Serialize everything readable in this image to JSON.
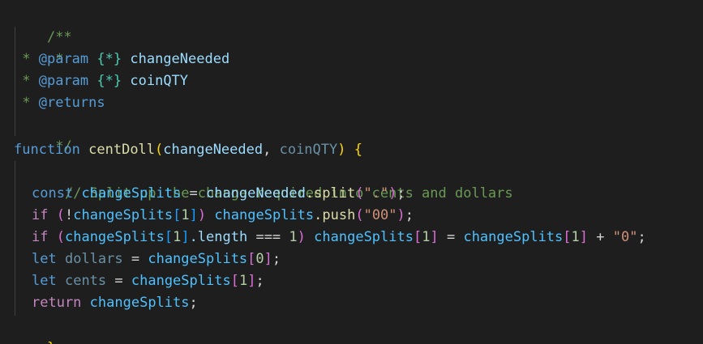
{
  "doc_comment": {
    "open": "/**",
    "star": " *",
    "param1_tag": "@param",
    "param1_type": "{*}",
    "param1_name": "changeNeeded",
    "param2_tag": "@param",
    "param2_type": "{*}",
    "param2_name": "coinQTY",
    "returns_tag": "@returns",
    "close": " */"
  },
  "function_decl": {
    "keyword": "function",
    "name": "centDoll",
    "open_paren": "(",
    "param1": "changeNeeded",
    "comma": ", ",
    "param2": "coinQTY",
    "close_paren": ")",
    "open_brace": "{"
  },
  "body": {
    "comment": "// Split up the change required into cents and dollars",
    "line1": {
      "kw": "const",
      "name": "changeSplits",
      "eq": " = ",
      "obj": "changeNeeded",
      "dot_method": ".split",
      "lp": "(",
      "str": "\".\"",
      "rp": ")",
      "semi": ";"
    },
    "line2": {
      "kw": "if",
      "lp": "(",
      "not": "!",
      "name": "changeSplits",
      "lb": "[",
      "idx": "1",
      "rb": "]",
      "rp": ")",
      "obj": "changeSplits",
      "dot_method": ".push",
      "lp2": "(",
      "str": "\"00\"",
      "rp2": ")",
      "semi": ";"
    },
    "line3": {
      "kw": "if",
      "lp": "(",
      "name": "changeSplits",
      "lb": "[",
      "idx": "1",
      "rb": "]",
      "prop": ".length",
      "op": " === ",
      "num": "1",
      "rp": ")",
      "name2": "changeSplits",
      "lb2": "[",
      "idx2": "1",
      "rb2": "]",
      "eq": " = ",
      "name3": "changeSplits",
      "lb3": "[",
      "idx3": "1",
      "rb3": "]",
      "plus": " + ",
      "str": "\"0\"",
      "semi": ";"
    },
    "line4": {
      "kw": "let",
      "name": "dollars",
      "eq": " = ",
      "obj": "changeSplits",
      "lb": "[",
      "idx": "0",
      "rb": "]",
      "semi": ";"
    },
    "line5": {
      "kw": "let",
      "name": "cents",
      "eq": " = ",
      "obj": "changeSplits",
      "lb": "[",
      "idx": "1",
      "rb": "]",
      "semi": ";"
    },
    "line6": {
      "kw": "return",
      "name": "changeSplits",
      "semi": ";"
    }
  },
  "close_brace": "}",
  "colors": {
    "background": "#1e1e1e",
    "comment": "#6a9955",
    "keyword": "#569cd6",
    "control": "#c586c0",
    "function": "#dcdcaa",
    "variable": "#9cdcfe",
    "string": "#ce9178",
    "number": "#b5cea8",
    "bracket_level1": "#ffd700",
    "bracket_level2": "#da70d6",
    "bracket_level3": "#179fff"
  }
}
